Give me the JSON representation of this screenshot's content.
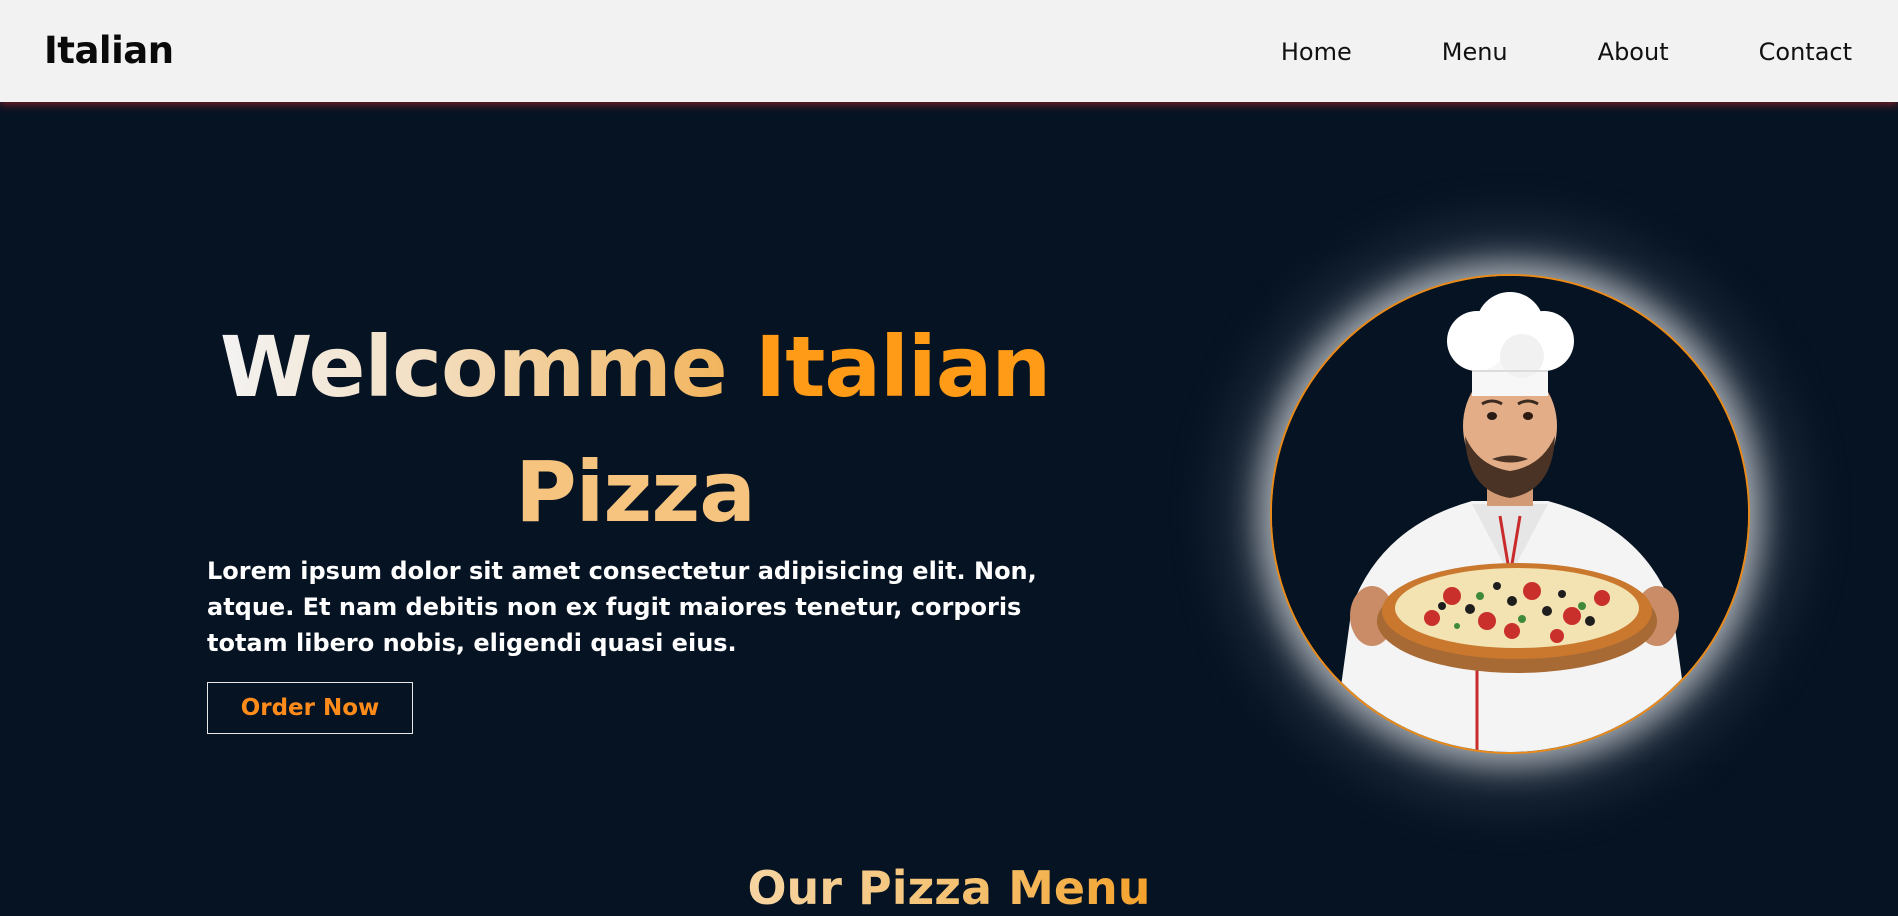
{
  "navbar": {
    "brand": "Italian",
    "links": [
      "Home",
      "Menu",
      "About",
      "Contact"
    ]
  },
  "hero": {
    "title_part1": "Welcomme",
    "title_part2": "Italian",
    "title_part3": "Pizza",
    "description": "Lorem ipsum dolor sit amet consectetur adipisicing elit. Non, atque. Et nam debitis non ex fugit maiores tenetur, corporis totam libero nobis, eligendi quasi eius.",
    "order_button": "Order Now",
    "image_icon": "chef-holding-pizza-image"
  },
  "menu_section": {
    "heading": "Our Pizza Menu"
  },
  "colors": {
    "background": "#061323",
    "navbar_bg": "#f2f2f2",
    "accent_orange": "#ff9b17",
    "accent_light": "#f6c47f",
    "button_text": "#ff8c1a"
  }
}
